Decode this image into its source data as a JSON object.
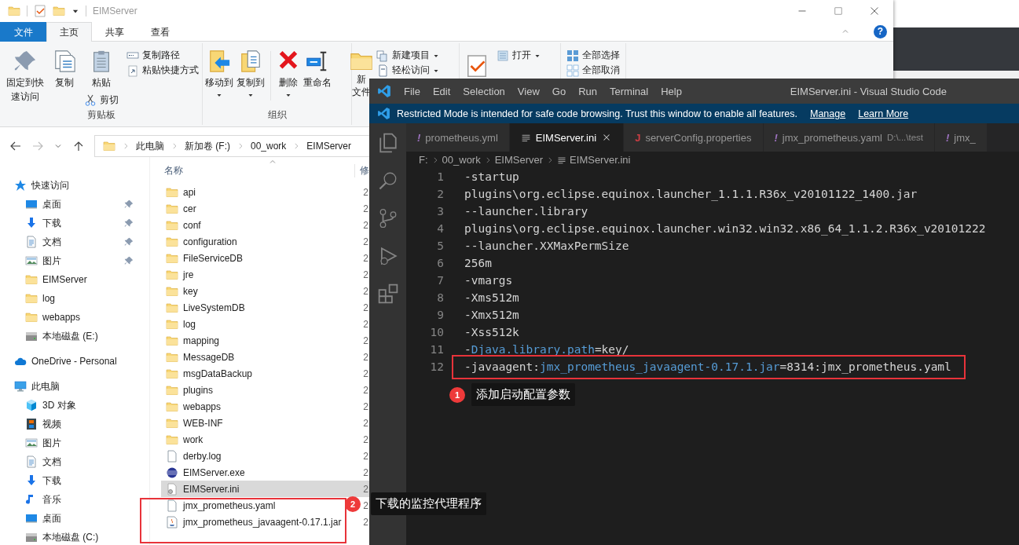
{
  "explorer": {
    "title": "EIMServer",
    "ribbon_tabs": [
      {
        "label": "文件",
        "kind": "file",
        "selected": false
      },
      {
        "label": "主页",
        "kind": "tab",
        "selected": true
      },
      {
        "label": "共享",
        "kind": "tab",
        "selected": false
      },
      {
        "label": "查看",
        "kind": "tab",
        "selected": false
      }
    ],
    "help_glyph": "?",
    "ribbon": {
      "clipboard": {
        "pin": "固定到快速访问",
        "copy": "复制",
        "paste": "粘贴",
        "cut": "剪切",
        "copy_path": "复制路径",
        "paste_shortcut": "粘贴快捷方式",
        "group": "剪贴板"
      },
      "organize": {
        "move_to": "移动到",
        "copy_to": "复制到",
        "delete": "删除",
        "rename": "重命名",
        "group": "组织"
      },
      "new": {
        "new_folder_lines": [
          "新",
          "文件"
        ],
        "new_item": "新建项目",
        "easy_access": "轻松访问"
      },
      "open": {
        "open": "打开"
      },
      "select": {
        "select_all": "全部选择",
        "select_none": "全部取消"
      }
    },
    "breadcrumbs": [
      "此电脑",
      "新加卷 (F:)",
      "00_work",
      "EIMServer"
    ],
    "nav": [
      {
        "label": "快速访问",
        "kind": "quick",
        "children": [
          {
            "label": "桌面",
            "kind": "desktop",
            "pinned": true
          },
          {
            "label": "下载",
            "kind": "download",
            "pinned": true
          },
          {
            "label": "文档",
            "kind": "doc",
            "pinned": true
          },
          {
            "label": "图片",
            "kind": "image",
            "pinned": true
          },
          {
            "label": "EIMServer",
            "kind": "folder",
            "pinned": false
          },
          {
            "label": "log",
            "kind": "folder",
            "pinned": false
          },
          {
            "label": "webapps",
            "kind": "folder",
            "pinned": false
          },
          {
            "label": "本地磁盘 (E:)",
            "kind": "drive",
            "pinned": false
          }
        ]
      },
      {
        "label": "OneDrive - Personal",
        "kind": "cloud"
      },
      {
        "label": "此电脑",
        "kind": "pc",
        "children": [
          {
            "label": "3D 对象",
            "kind": "cube",
            "pinned": false
          },
          {
            "label": "视频",
            "kind": "video",
            "pinned": false
          },
          {
            "label": "图片",
            "kind": "image",
            "pinned": false
          },
          {
            "label": "文档",
            "kind": "doc",
            "pinned": false
          },
          {
            "label": "下载",
            "kind": "download",
            "pinned": false
          },
          {
            "label": "音乐",
            "kind": "music",
            "pinned": false
          },
          {
            "label": "桌面",
            "kind": "desktop",
            "pinned": false
          },
          {
            "label": "本地磁盘 (C:)",
            "kind": "drive",
            "pinned": false
          }
        ]
      }
    ],
    "columns": [
      "名称",
      "修"
    ],
    "files": [
      {
        "name": "api",
        "kind": "folder",
        "modified": "2",
        "selected": false
      },
      {
        "name": "cer",
        "kind": "folder",
        "modified": "2",
        "selected": false
      },
      {
        "name": "conf",
        "kind": "folder",
        "modified": "2",
        "selected": false
      },
      {
        "name": "configuration",
        "kind": "folder",
        "modified": "2",
        "selected": false
      },
      {
        "name": "FileServiceDB",
        "kind": "folder",
        "modified": "2",
        "selected": false
      },
      {
        "name": "jre",
        "kind": "folder",
        "modified": "2",
        "selected": false
      },
      {
        "name": "key",
        "kind": "folder",
        "modified": "2",
        "selected": false
      },
      {
        "name": "LiveSystemDB",
        "kind": "folder",
        "modified": "2",
        "selected": false
      },
      {
        "name": "log",
        "kind": "folder",
        "modified": "2",
        "selected": false
      },
      {
        "name": "mapping",
        "kind": "folder",
        "modified": "2",
        "selected": false
      },
      {
        "name": "MessageDB",
        "kind": "folder",
        "modified": "2",
        "selected": false
      },
      {
        "name": "msgDataBackup",
        "kind": "folder",
        "modified": "2",
        "selected": false
      },
      {
        "name": "plugins",
        "kind": "folder",
        "modified": "2",
        "selected": false
      },
      {
        "name": "webapps",
        "kind": "folder",
        "modified": "2",
        "selected": false
      },
      {
        "name": "WEB-INF",
        "kind": "folder",
        "modified": "2",
        "selected": false
      },
      {
        "name": "work",
        "kind": "folder",
        "modified": "2",
        "selected": false
      },
      {
        "name": "derby.log",
        "kind": "text",
        "modified": "2",
        "selected": false
      },
      {
        "name": "EIMServer.exe",
        "kind": "exe",
        "modified": "2",
        "selected": false
      },
      {
        "name": "EIMServer.ini",
        "kind": "ini",
        "modified": "2",
        "selected": true
      },
      {
        "name": "jmx_prometheus.yaml",
        "kind": "text",
        "modified": "2",
        "selected": false
      },
      {
        "name": "jmx_prometheus_javaagent-0.17.1.jar",
        "kind": "jar",
        "modified": "2",
        "selected": false
      }
    ]
  },
  "vscode": {
    "menu": [
      "File",
      "Edit",
      "Selection",
      "View",
      "Go",
      "Run",
      "Terminal",
      "Help"
    ],
    "title": "EIMServer.ini - Visual Studio Code",
    "banner": {
      "text": "Restricted Mode is intended for safe code browsing. Trust this window to enable all features.",
      "links": [
        "Manage",
        "Learn More"
      ]
    },
    "tabs": [
      {
        "label": "prometheus.yml",
        "kind": "yaml",
        "glyph": "!",
        "selected": false
      },
      {
        "label": "EIMServer.ini",
        "kind": "ini",
        "selected": true
      },
      {
        "label": "serverConfig.properties",
        "kind": "java",
        "glyph": "J",
        "selected": false
      },
      {
        "label": "jmx_prometheus.yaml",
        "kind": "yaml",
        "glyph": "!",
        "description": "D:\\...\\test",
        "selected": false
      },
      {
        "label": "jmx_",
        "kind": "yaml",
        "glyph": "!",
        "selected": false
      }
    ],
    "breadcrumbs": [
      "F:",
      "00_work",
      "EIMServer",
      "EIMServer.ini"
    ],
    "lines": [
      {
        "number": "1",
        "segments": [
          {
            "text": "-startup",
            "kind": "plain"
          }
        ]
      },
      {
        "number": "2",
        "segments": [
          {
            "text": "plugins\\org.eclipse.equinox.launcher_1.1.1.R36x_v20101122_1400.jar",
            "kind": "plain"
          }
        ]
      },
      {
        "number": "3",
        "segments": [
          {
            "text": "--launcher.library",
            "kind": "plain"
          }
        ]
      },
      {
        "number": "4",
        "segments": [
          {
            "text": "plugins\\org.eclipse.equinox.launcher.win32.win32.x86_64_1.1.2.R36x_v20101222",
            "kind": "plain"
          }
        ]
      },
      {
        "number": "5",
        "segments": [
          {
            "text": "--launcher.XXMaxPermSize",
            "kind": "plain"
          }
        ]
      },
      {
        "number": "6",
        "segments": [
          {
            "text": "256m",
            "kind": "plain"
          }
        ]
      },
      {
        "number": "7",
        "segments": [
          {
            "text": "-vmargs",
            "kind": "plain"
          }
        ]
      },
      {
        "number": "8",
        "segments": [
          {
            "text": "-Xms512m",
            "kind": "plain"
          }
        ]
      },
      {
        "number": "9",
        "segments": [
          {
            "text": "-Xmx512m",
            "kind": "plain"
          }
        ]
      },
      {
        "number": "10",
        "segments": [
          {
            "text": "-Xss512k",
            "kind": "plain"
          }
        ]
      },
      {
        "number": "11",
        "segments": [
          {
            "text": "-",
            "kind": "plain"
          },
          {
            "text": "Djava.library.path",
            "kind": "key"
          },
          {
            "text": "=key/",
            "kind": "plain"
          }
        ]
      },
      {
        "number": "12",
        "segments": [
          {
            "text": "-javaagent:",
            "kind": "plain"
          },
          {
            "text": "jmx_prometheus_javaagent-0.17.1.jar",
            "kind": "key"
          },
          {
            "text": "=8314:jmx_prometheus.yaml",
            "kind": "plain"
          }
        ]
      }
    ]
  },
  "annotations": [
    {
      "number": "1",
      "text": "添加启动配置参数"
    },
    {
      "number": "2",
      "text": "下载的监控代理程序"
    }
  ]
}
